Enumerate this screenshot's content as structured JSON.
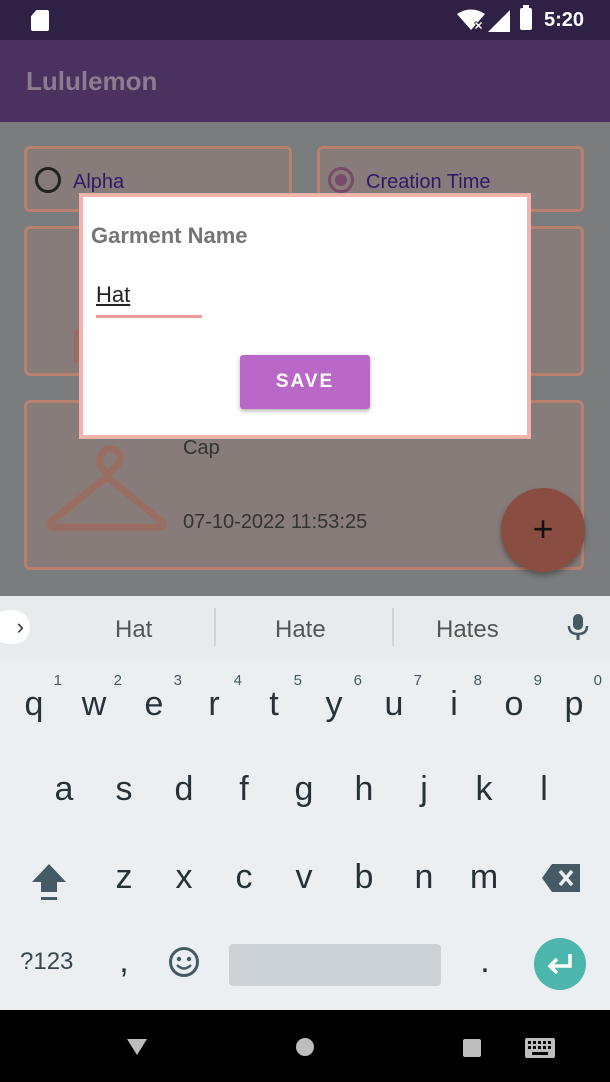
{
  "status_bar": {
    "time": "5:20"
  },
  "app_bar": {
    "title": "Lululemon"
  },
  "sort_options": [
    {
      "label": "Alpha",
      "selected": false
    },
    {
      "label": "Creation Time",
      "selected": true
    }
  ],
  "garments": [
    {
      "name": "",
      "date": ""
    },
    {
      "name": "Cap",
      "date": "07-10-2022 11:53:25"
    }
  ],
  "fab": {
    "symbol": "+"
  },
  "dialog": {
    "title": "Garment Name",
    "input_value": "Hat",
    "save_label": "SAVE"
  },
  "keyboard": {
    "suggestions": [
      "Hat",
      "Hate",
      "Hates"
    ],
    "expand_symbol": "›",
    "row1": [
      {
        "key": "q",
        "num": "1"
      },
      {
        "key": "w",
        "num": "2"
      },
      {
        "key": "e",
        "num": "3"
      },
      {
        "key": "r",
        "num": "4"
      },
      {
        "key": "t",
        "num": "5"
      },
      {
        "key": "y",
        "num": "6"
      },
      {
        "key": "u",
        "num": "7"
      },
      {
        "key": "i",
        "num": "8"
      },
      {
        "key": "o",
        "num": "9"
      },
      {
        "key": "p",
        "num": "0"
      }
    ],
    "row2": [
      "a",
      "s",
      "d",
      "f",
      "g",
      "h",
      "j",
      "k",
      "l"
    ],
    "row3": [
      "z",
      "x",
      "c",
      "v",
      "b",
      "n",
      "m"
    ],
    "symbols_label": "?123",
    "comma": ",",
    "period": ".",
    "accent_color": "#4db6ac"
  },
  "colors": {
    "primary": "#ba68c8",
    "dialog_border": "#f4b2ad",
    "status_bar": "#2e2145",
    "app_bar": "#4a3160"
  }
}
